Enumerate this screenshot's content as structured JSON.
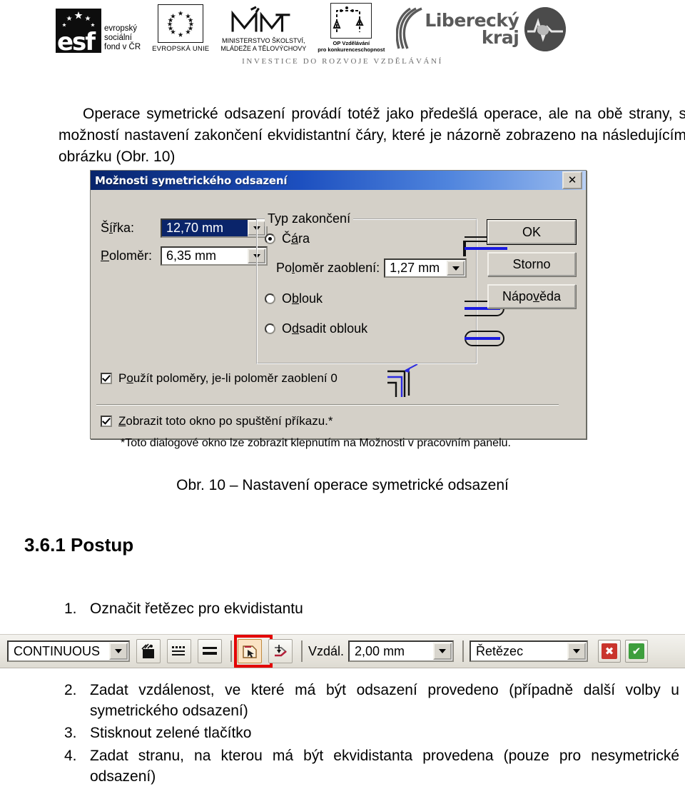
{
  "banner": {
    "esf": {
      "line1": "evropský",
      "line2": "sociální",
      "line3": "fond v ČR",
      "mark": "esf"
    },
    "eu": {
      "caption": "EVROPSKÁ UNIE"
    },
    "msmt": {
      "mark": "MŠMT",
      "line1": "MINISTERSTVO ŠKOLSTVÍ,",
      "line2": "MLÁDEŽE A TĚLOVÝCHOVY"
    },
    "op": {
      "line1": "OP Vzdělávání",
      "line2": "pro konkurenceschopnost"
    },
    "liberecky": {
      "line1": "Liberecký",
      "line2": "kraj"
    },
    "tagline": "INVESTICE DO ROZVOJE VZDĚLÁVÁNÍ"
  },
  "intro": "Operace symetrické odsazení provádí totéž jako předešlá operace, ale na obě strany, s možností nastavení zakončení ekvidistantní čáry, které je názorně zobrazeno na následujícím obrázku (Obr. 10)",
  "dialog": {
    "title": "Možnosti symetrického odsazení",
    "close_label": "✕",
    "width_label": "Šířka:",
    "width_value": "12,70 mm",
    "radius_label": "Poloměr:",
    "radius_value": "6,35 mm",
    "group_legend": "Typ zakončení",
    "option_line": "Čára",
    "fillet_label": "Poloměr zaoblení:",
    "fillet_value": "1,27 mm",
    "option_arc": "Oblouk",
    "option_offset_arc": "Odsadit oblouk",
    "check_radii": "Použít poloměry, je-li poloměr zaoblení 0",
    "check_show": "Zobrazit toto okno po spuštění příkazu.*",
    "footnote": "*Toto dialogové okno lze zobrazit klepnutím na Možnosti v pracovním panelu.",
    "btn_ok": "OK",
    "btn_cancel": "Storno",
    "btn_help": "Nápověda"
  },
  "figure_caption": "Obr. 10 – Nastavení operace symetrické odsazení",
  "section_heading": "3.6.1 Postup",
  "steps": [
    {
      "num": "1.",
      "text": "Označit řetězec pro ekvidistantu"
    },
    {
      "num": "2.",
      "text": "Zadat vzdálenost, ve které má být odsazení provedeno (případně další volby u symetrického odsazení)"
    },
    {
      "num": "3.",
      "text": "Stisknout zelené tlačítko"
    },
    {
      "num": "4.",
      "text": "Zadat stranu, na kterou má být ekvidistanta provedena (pouze pro nesymetrické odsazení)"
    }
  ],
  "toolbar": {
    "linetype_value": "CONTINUOUS",
    "distance_label": "Vzdál.",
    "distance_value": "2,00 mm",
    "mode_value": "Řetězec",
    "cancel_glyph": "✖",
    "confirm_glyph": "✔",
    "colors": {
      "highlight": "#e40000",
      "cancel": "#c9342c",
      "confirm": "#3d9e3d",
      "accent": "#1a1ae0"
    }
  }
}
